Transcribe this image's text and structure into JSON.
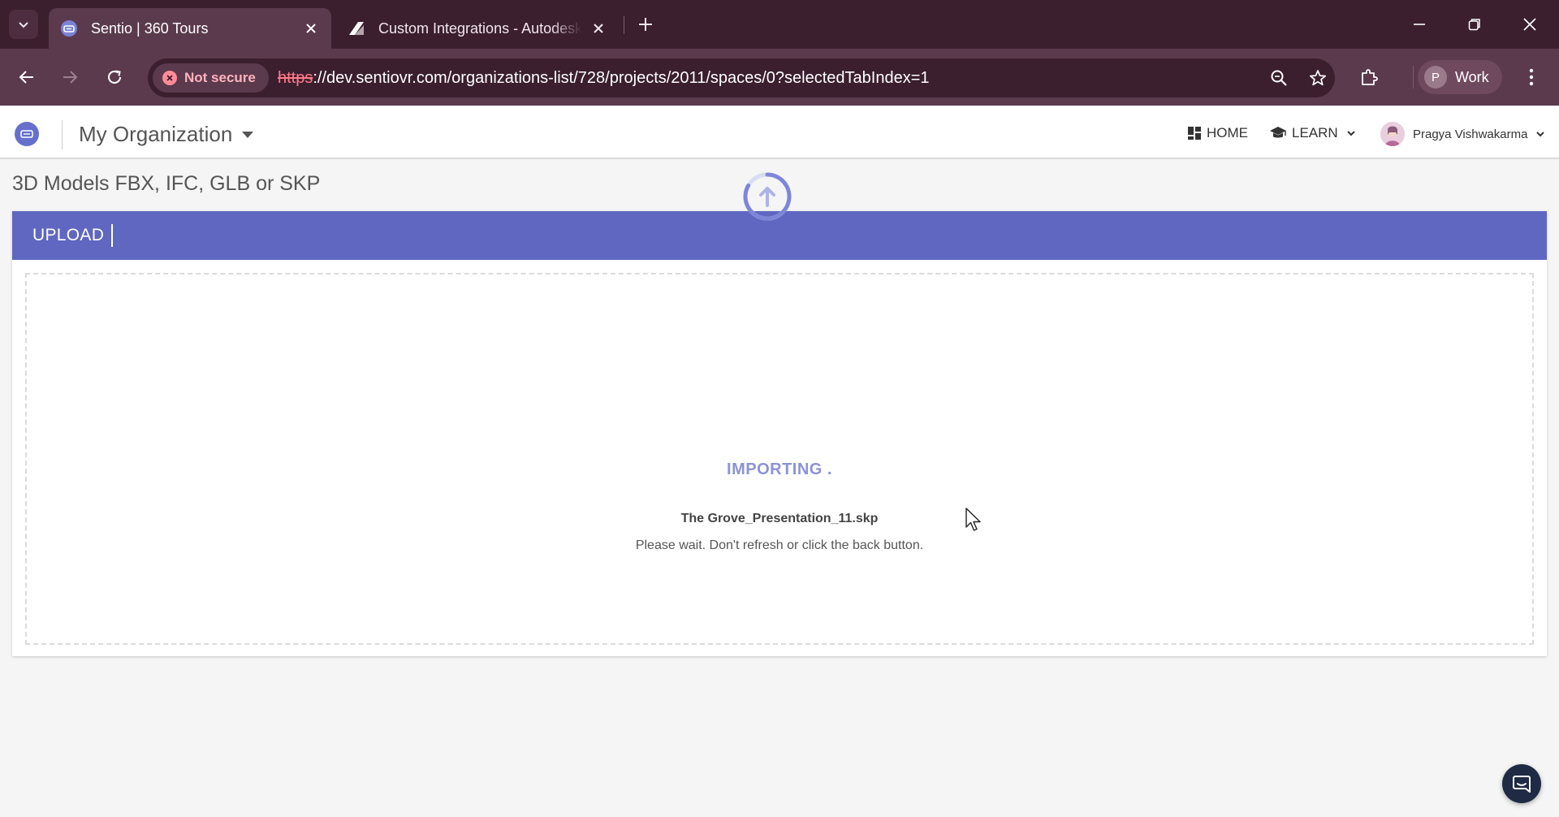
{
  "browser": {
    "tabs": [
      {
        "title": "Sentio | 360 Tours",
        "active": true
      },
      {
        "title": "Custom Integrations - Autodesk",
        "active": false
      }
    ],
    "address": {
      "security_label": "Not secure",
      "url_scheme": "https",
      "url_rest": "://dev.sentiovr.com/organizations-list/728/projects/2011/spaces/0?selectedTabIndex=1"
    },
    "profile": {
      "initial": "P",
      "label": "Work"
    }
  },
  "app": {
    "organization": "My Organization",
    "nav": {
      "home": "HOME",
      "learn": "LEARN"
    },
    "user_name": "Pragya Vishwakarma",
    "accent_color": "#5f67c1"
  },
  "page": {
    "title": "3D Models FBX, IFC, GLB or SKP",
    "upload_tab": "UPLOAD",
    "status": "IMPORTING .",
    "file_name": "The Grove_Presentation_11.skp",
    "wait_message": "Please wait. Don't refresh or click the back button."
  }
}
